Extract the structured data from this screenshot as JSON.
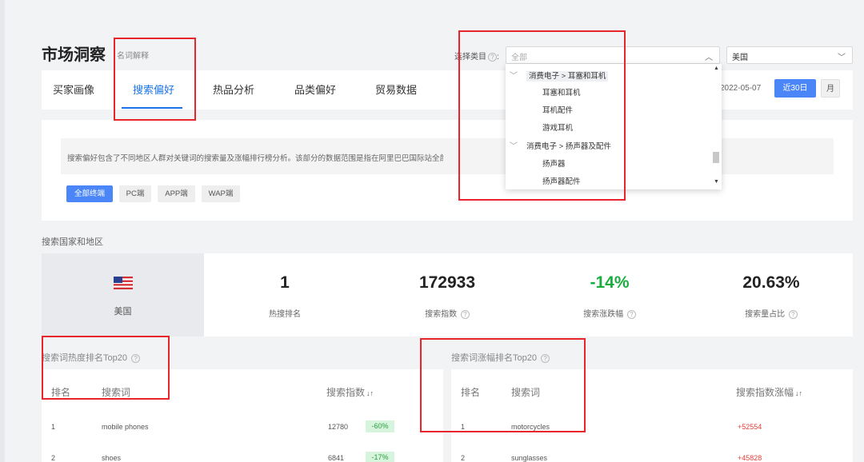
{
  "header": {
    "title": "市场洞察",
    "glossary": "名词解释",
    "category_label": "选择类目",
    "category_value": "全部",
    "country_value": "美国"
  },
  "tabs": [
    {
      "label": "买家画像"
    },
    {
      "label": "搜索偏好"
    },
    {
      "label": "热品分析"
    },
    {
      "label": "品类偏好"
    },
    {
      "label": "贸易数据"
    }
  ],
  "date_controls": {
    "date": "2022-05-07",
    "range_label": "近30日",
    "month_label": "月"
  },
  "description": "搜索偏好包含了不同地区人群对关键词的搜索量及涨幅排行榜分析。该部分的数据范围是指在阿里巴巴国际站全部有搜索行为的买家",
  "platform_chips": [
    "全部终端",
    "PC端",
    "APP端",
    "WAP端"
  ],
  "region_section": {
    "label": "搜索国家和地区",
    "country": "美国",
    "stats": [
      {
        "value": "1",
        "label": "热搜排名"
      },
      {
        "value": "172933",
        "label": "搜索指数"
      },
      {
        "value": "-14%",
        "label": "搜索涨跌幅"
      },
      {
        "value": "20.63%",
        "label": "搜索量占比"
      }
    ]
  },
  "hot_table": {
    "title": "搜索词热度排名Top20",
    "headers": {
      "rank": "排名",
      "term": "搜索词",
      "index": "搜索指数"
    },
    "rows": [
      {
        "rank": "1",
        "term": "mobile phones",
        "index": "12780",
        "change": "-60%"
      },
      {
        "rank": "2",
        "term": "shoes",
        "index": "6841",
        "change": "-17%"
      }
    ]
  },
  "rise_table": {
    "title": "搜索词涨幅排名Top20",
    "headers": {
      "rank": "排名",
      "term": "搜索词",
      "growth": "搜索指数涨幅"
    },
    "rows": [
      {
        "rank": "1",
        "term": "motorcycles",
        "growth": "+52554"
      },
      {
        "rank": "2",
        "term": "sunglasses",
        "growth": "+45828"
      }
    ]
  },
  "dropdown": {
    "items": [
      {
        "label": "消费电子 > 耳塞和耳机"
      },
      {
        "label": "耳塞和耳机"
      },
      {
        "label": "耳机配件"
      },
      {
        "label": "游戏耳机"
      },
      {
        "label": "消费电子 > 扬声器及配件"
      },
      {
        "label": "扬声器"
      },
      {
        "label": "扬声器配件"
      }
    ]
  },
  "colors": {
    "accent": "#1a73e8",
    "button_blue": "#4a86f7",
    "positive_green": "#1aad3d",
    "growth_red": "#e8403b",
    "annotation_red": "#e8252a"
  }
}
